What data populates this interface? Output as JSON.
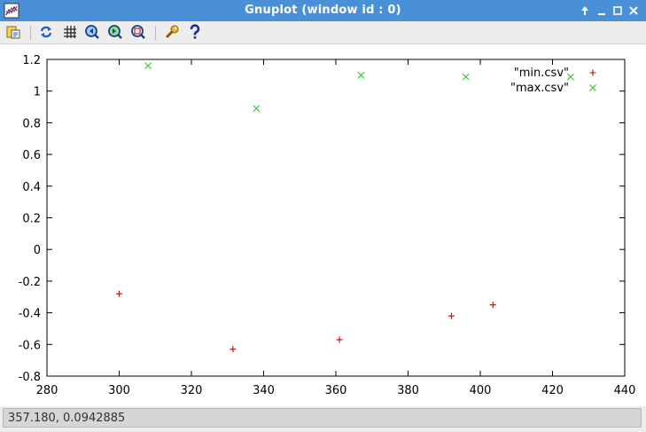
{
  "window": {
    "title": "Gnuplot (window id : 0)",
    "controls": [
      "maximize-up",
      "minimize",
      "maximize",
      "close"
    ]
  },
  "toolbar": {
    "buttons": [
      "export-icon",
      "replot-icon",
      "grid-icon",
      "zoom-previous-icon",
      "zoom-next-icon",
      "autoscale-icon",
      "options-icon",
      "help-icon"
    ]
  },
  "status": {
    "text": "357.180,  0.0942885"
  },
  "colors": {
    "titlebar": "#4a90d9",
    "series_min": "#cc0000",
    "series_max": "#22cc22"
  },
  "chart_data": {
    "type": "scatter",
    "title": "",
    "xlabel": "",
    "ylabel": "",
    "xlim": [
      280,
      440
    ],
    "ylim": [
      -0.8,
      1.2
    ],
    "x_ticks": [
      280,
      300,
      320,
      340,
      360,
      380,
      400,
      420,
      440
    ],
    "y_ticks": [
      1.2,
      1,
      0.8,
      0.6,
      0.4,
      0.2,
      0,
      -0.2,
      -0.4,
      -0.6,
      -0.8
    ],
    "legend_position": "top-right",
    "grid": false,
    "series": [
      {
        "name": "\"min.csv\"",
        "marker": "plus",
        "color": "#cc0000",
        "points": [
          [
            300,
            -0.28
          ],
          [
            331.5,
            -0.63
          ],
          [
            361,
            -0.57
          ],
          [
            392,
            -0.42
          ],
          [
            403.5,
            -0.35
          ]
        ]
      },
      {
        "name": "\"max.csv\"",
        "marker": "cross",
        "color": "#22cc22",
        "points": [
          [
            308,
            1.16
          ],
          [
            338,
            0.89
          ],
          [
            367,
            1.1
          ],
          [
            396,
            1.09
          ],
          [
            425,
            1.09
          ]
        ]
      }
    ]
  }
}
